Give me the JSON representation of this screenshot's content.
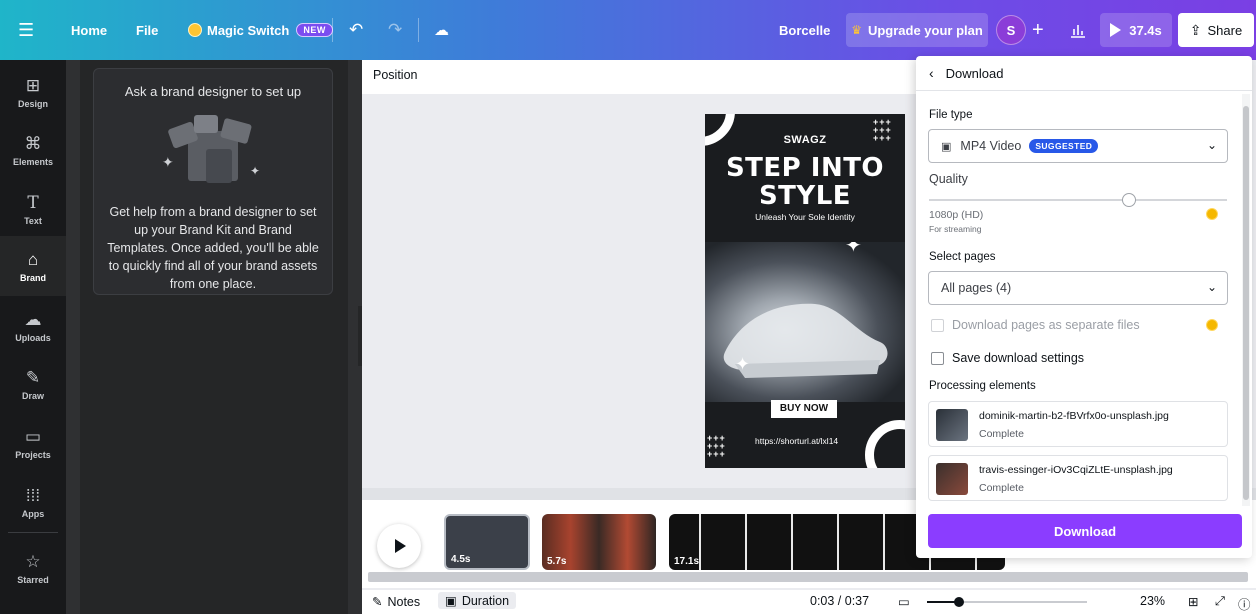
{
  "topbar": {
    "home": "Home",
    "file": "File",
    "magic_switch": "Magic Switch",
    "new_badge": "NEW",
    "brand_name": "Borcelle",
    "upgrade": "Upgrade your plan",
    "avatar_initial": "S",
    "play_time": "37.4s",
    "share": "Share"
  },
  "rail": {
    "items": [
      {
        "label": "Design",
        "icon": "layout-icon"
      },
      {
        "label": "Elements",
        "icon": "shapes-icon"
      },
      {
        "label": "Text",
        "icon": "text-icon"
      },
      {
        "label": "Brand",
        "icon": "brand-icon"
      },
      {
        "label": "Uploads",
        "icon": "cloud-upload-icon"
      },
      {
        "label": "Draw",
        "icon": "pen-icon"
      },
      {
        "label": "Projects",
        "icon": "folder-icon"
      },
      {
        "label": "Apps",
        "icon": "apps-grid-icon"
      },
      {
        "label": "Starred",
        "icon": "star-icon"
      }
    ]
  },
  "brand_panel": {
    "title": "Ask a brand designer to set up",
    "description": "Get help from a brand designer to set up your Brand Kit and Brand Templates. Once added, you'll be able to quickly find all of your brand assets from one place."
  },
  "canvas": {
    "position_label": "Position",
    "design": {
      "brand": "SWAGZ",
      "headline_1": "STEP INTO",
      "headline_2": "STYLE",
      "subtitle": "Unleash Your Sole Identity",
      "cta": "BUY NOW",
      "url": "https://shorturl.at/lxl14"
    }
  },
  "timeline": {
    "clips": [
      {
        "duration": "4.5s"
      },
      {
        "duration": "5.7s"
      },
      {
        "duration": "17.1s"
      }
    ]
  },
  "status": {
    "notes": "Notes",
    "duration": "Duration",
    "time": "0:03 / 0:37",
    "zoom": "23%",
    "zoom_fraction": 0.2
  },
  "download": {
    "title": "Download",
    "file_type_label": "File type",
    "file_type_value": "MP4 Video",
    "suggested": "SUGGESTED",
    "quality_label": "Quality",
    "quality_value": "1080p (HD)",
    "quality_note": "For streaming",
    "quality_fraction": 0.67,
    "select_pages_label": "Select pages",
    "pages_value": "All pages (4)",
    "separate_files": "Download pages as separate files",
    "save_settings": "Save download settings",
    "processing_label": "Processing elements",
    "files": [
      {
        "name": "dominik-martin-b2-fBVrfx0o-unsplash.jpg",
        "status": "Complete"
      },
      {
        "name": "travis-essinger-iOv3CqiZLtE-unsplash.jpg",
        "status": "Complete"
      }
    ],
    "button": "Download",
    "accent": "#8b3dff"
  }
}
